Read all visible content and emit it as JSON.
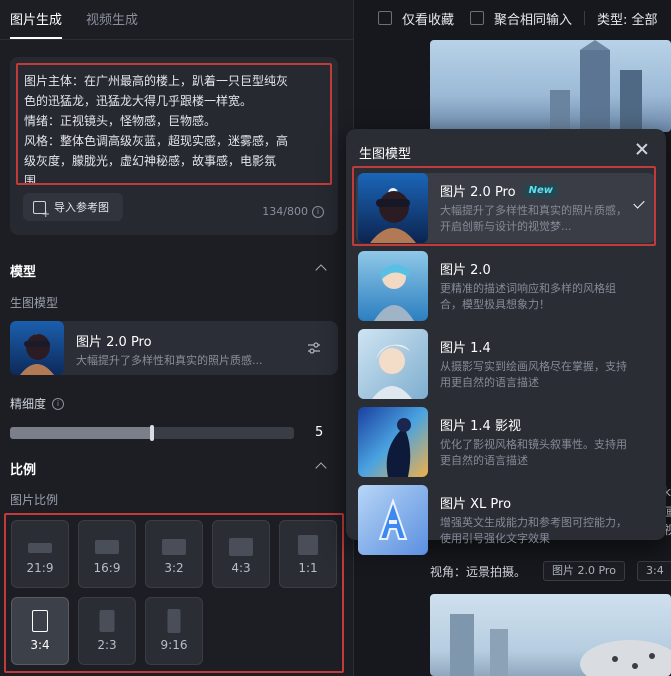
{
  "tabs": [
    {
      "label": "图片生成",
      "active": true
    },
    {
      "label": "视频生成",
      "active": false
    }
  ],
  "prompt": {
    "lines": [
      "图片主体：在广州最高的楼上，趴着一只巨型纯灰",
      "色的迅猛龙，迅猛龙大得几乎跟楼一样宽。",
      "情绪：正视镜头，怪物感，巨物感。",
      "风格：整体色调高级灰蓝，超现实感，迷雾感，高",
      "级灰度，朦胧光，虚幻神秘感，故事感，电影氛",
      "围"
    ],
    "ref_button": "导入参考图",
    "char_count": "134/800"
  },
  "model_section": {
    "title": "模型",
    "sublabel": "生图模型",
    "selected": {
      "name": "图片 2.0 Pro",
      "desc": "大幅提升了多样性和真实的照片质感..."
    }
  },
  "precision": {
    "label": "精细度",
    "value": "5",
    "level": 0.5
  },
  "ratio_section": {
    "title": "比例",
    "sublabel": "图片比例",
    "options": [
      "21:9",
      "16:9",
      "3:2",
      "4:3",
      "1:1",
      "3:4",
      "2:3",
      "9:16"
    ],
    "selected": "3:4"
  },
  "filters": {
    "fav_only": "仅看收藏",
    "merge_same": "聚合相同输入",
    "type": "类型: 全部"
  },
  "gallery": {
    "caption": "视角：远景拍摄。",
    "tag1": "图片 2.0 Pro",
    "tag2": "3:4",
    "edge_text": [
      "k",
      "画",
      "视"
    ]
  },
  "dropdown": {
    "title": "生图模型",
    "items": [
      {
        "name": "图片 2.0 Pro",
        "badge": "New",
        "desc": "大幅提升了多样性和真实的照片质感，开启创新与设计的视觉梦...",
        "selected": true
      },
      {
        "name": "图片 2.0",
        "badge": "",
        "desc": "更精准的描述词响应和多样的风格组合，模型极具想象力！",
        "selected": false
      },
      {
        "name": "图片 1.4",
        "badge": "",
        "desc": "从摄影写实到绘画风格尽在掌握，支持用更自然的语言描述",
        "selected": false
      },
      {
        "name": "图片 1.4 影视",
        "badge": "",
        "desc": "优化了影视风格和镜头叙事性。支持用更自然的语言描述",
        "selected": false
      },
      {
        "name": "图片 XL Pro",
        "badge": "",
        "desc": "增强英文生成能力和参考图可控能力，使用引号强化文字效果",
        "selected": false
      }
    ]
  }
}
